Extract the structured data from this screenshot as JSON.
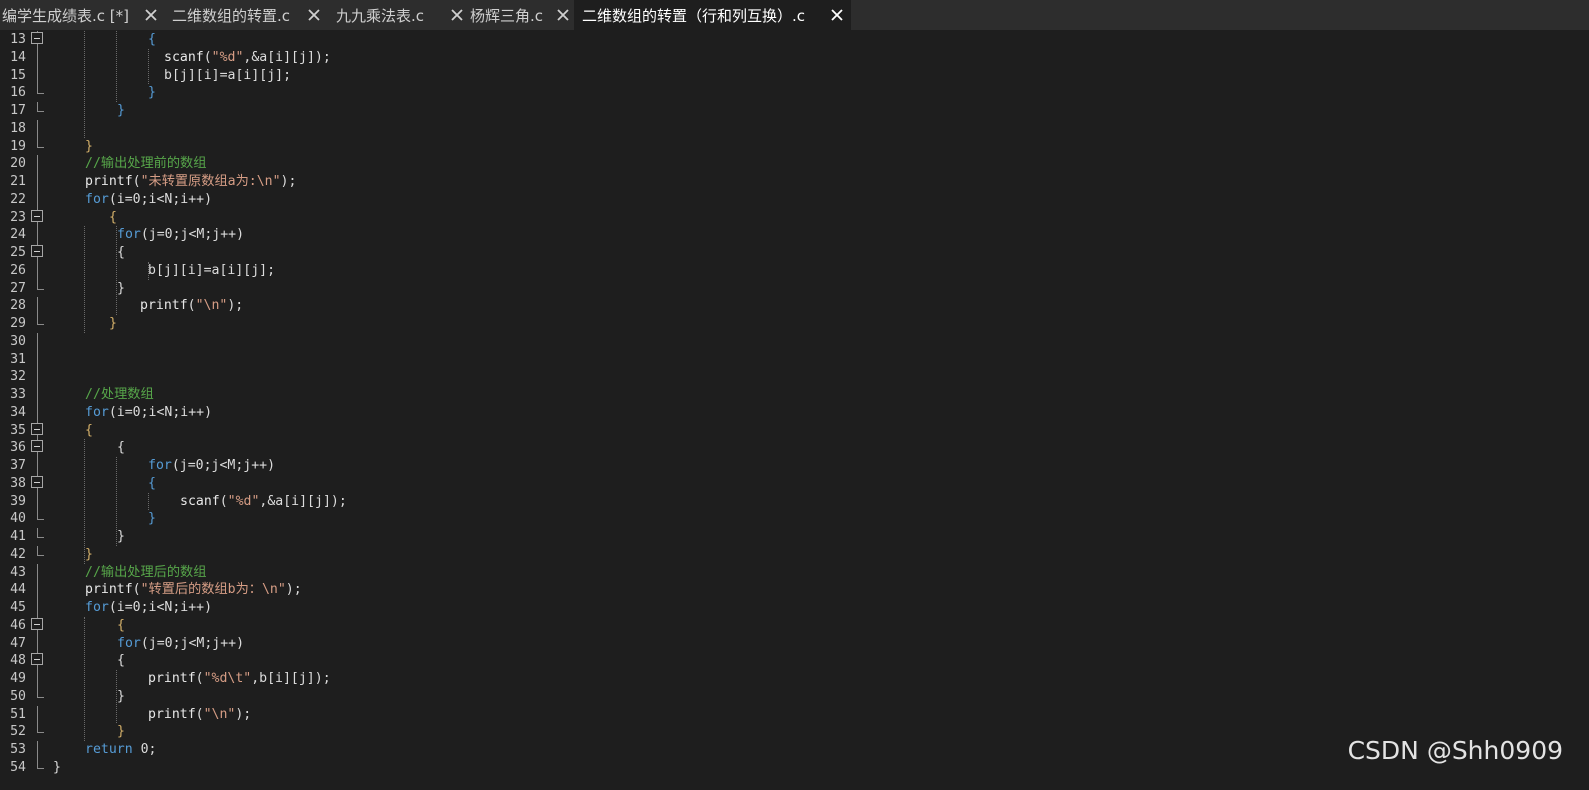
{
  "colors": {
    "background": "#1e1e1e",
    "tab_bar": "#2d2d2d",
    "keyword": "#569cd6",
    "function": "#e8e8e8",
    "string": "#d69d85",
    "comment": "#57a64a",
    "brace": "#d4b06a",
    "text": "#dcdcdc"
  },
  "tabs": [
    {
      "title": "编学生成绩表.c [*]",
      "close_icon": "close-icon",
      "active": false
    },
    {
      "title": "二维数组的转置.c",
      "close_icon": "close-icon",
      "active": false
    },
    {
      "title": "九九乘法表.c",
      "close_icon": "close-icon",
      "active": false
    },
    {
      "title": "杨辉三角.c",
      "close_icon": "close-icon",
      "active": false
    },
    {
      "title": "二维数组的转置（行和列互换）.c",
      "close_icon": "close-icon",
      "active": true
    }
  ],
  "editor": {
    "lines": [
      {
        "number": "13",
        "fold": "start",
        "tokens": [
          {
            "t": "{",
            "c": "bk"
          }
        ]
      },
      {
        "number": "14",
        "fold": "line",
        "tokens": [
          {
            "t": "scanf",
            "c": "fn"
          },
          {
            "t": "(",
            "c": "tx"
          },
          {
            "t": "\"%d\"",
            "c": "st"
          },
          {
            "t": ",&a[i][j]);",
            "c": "tx"
          }
        ]
      },
      {
        "number": "15",
        "fold": "line",
        "tokens": [
          {
            "t": "b[j][i]=a[i][j];",
            "c": "tx"
          }
        ]
      },
      {
        "number": "16",
        "fold": "end",
        "tokens": [
          {
            "t": "}",
            "c": "bk"
          }
        ]
      },
      {
        "number": "17",
        "fold": "end",
        "tokens": [
          {
            "t": "}",
            "c": "bk"
          }
        ]
      },
      {
        "number": "18",
        "fold": "line",
        "tokens": []
      },
      {
        "number": "19",
        "fold": "end",
        "tokens": [
          {
            "t": "}",
            "c": "br"
          }
        ]
      },
      {
        "number": "20",
        "fold": "line",
        "tokens": [
          {
            "t": "//输出处理前的数组",
            "c": "cm"
          }
        ]
      },
      {
        "number": "21",
        "fold": "line",
        "tokens": [
          {
            "t": "printf",
            "c": "fn"
          },
          {
            "t": "(",
            "c": "tx"
          },
          {
            "t": "\"未转置原数组a为:\\n\"",
            "c": "st"
          },
          {
            "t": ");",
            "c": "tx"
          }
        ]
      },
      {
        "number": "22",
        "fold": "line",
        "tokens": [
          {
            "t": "for",
            "c": "kw"
          },
          {
            "t": "(i=0;i<N;i++)",
            "c": "tx"
          }
        ]
      },
      {
        "number": "23",
        "fold": "start",
        "tokens": [
          {
            "t": "{",
            "c": "br"
          }
        ]
      },
      {
        "number": "24",
        "fold": "line",
        "tokens": [
          {
            "t": "for",
            "c": "kw"
          },
          {
            "t": "(j=0;j<M;j++)",
            "c": "tx"
          }
        ]
      },
      {
        "number": "25",
        "fold": "start",
        "tokens": [
          {
            "t": "{",
            "c": "tx"
          }
        ]
      },
      {
        "number": "26",
        "fold": "line",
        "tokens": [
          {
            "t": "b[j][i]=a[i][j];",
            "c": "tx"
          }
        ]
      },
      {
        "number": "27",
        "fold": "end",
        "tokens": [
          {
            "t": "}",
            "c": "tx"
          }
        ]
      },
      {
        "number": "28",
        "fold": "line",
        "tokens": [
          {
            "t": "printf",
            "c": "fn"
          },
          {
            "t": "(",
            "c": "tx"
          },
          {
            "t": "\"\\n\"",
            "c": "st"
          },
          {
            "t": ");",
            "c": "tx"
          }
        ]
      },
      {
        "number": "29",
        "fold": "end",
        "tokens": [
          {
            "t": "}",
            "c": "br"
          }
        ]
      },
      {
        "number": "30",
        "fold": "line",
        "tokens": []
      },
      {
        "number": "31",
        "fold": "line",
        "tokens": []
      },
      {
        "number": "32",
        "fold": "line",
        "tokens": []
      },
      {
        "number": "33",
        "fold": "line",
        "tokens": [
          {
            "t": "//处理数组",
            "c": "cm"
          }
        ]
      },
      {
        "number": "34",
        "fold": "line",
        "tokens": [
          {
            "t": "for",
            "c": "kw"
          },
          {
            "t": "(i=0;i<N;i++)",
            "c": "tx"
          }
        ]
      },
      {
        "number": "35",
        "fold": "start",
        "tokens": [
          {
            "t": "{",
            "c": "br"
          }
        ]
      },
      {
        "number": "36",
        "fold": "start",
        "tokens": [
          {
            "t": "{",
            "c": "tx"
          }
        ]
      },
      {
        "number": "37",
        "fold": "line",
        "tokens": [
          {
            "t": "for",
            "c": "kw"
          },
          {
            "t": "(j=0;j<M;j++)",
            "c": "tx"
          }
        ]
      },
      {
        "number": "38",
        "fold": "start",
        "tokens": [
          {
            "t": "{",
            "c": "bk"
          }
        ]
      },
      {
        "number": "39",
        "fold": "line",
        "tokens": [
          {
            "t": "scanf",
            "c": "fn"
          },
          {
            "t": "(",
            "c": "tx"
          },
          {
            "t": "\"%d\"",
            "c": "st"
          },
          {
            "t": ",&a[i][j]);",
            "c": "tx"
          }
        ]
      },
      {
        "number": "40",
        "fold": "end",
        "tokens": [
          {
            "t": "}",
            "c": "bk"
          }
        ]
      },
      {
        "number": "41",
        "fold": "end",
        "tokens": [
          {
            "t": "}",
            "c": "tx"
          }
        ]
      },
      {
        "number": "42",
        "fold": "end",
        "tokens": [
          {
            "t": "}",
            "c": "br"
          }
        ]
      },
      {
        "number": "43",
        "fold": "line",
        "tokens": [
          {
            "t": "//输出处理后的数组",
            "c": "cm"
          }
        ]
      },
      {
        "number": "44",
        "fold": "line",
        "tokens": [
          {
            "t": "printf",
            "c": "fn"
          },
          {
            "t": "(",
            "c": "tx"
          },
          {
            "t": "\"转置后的数组b为：\\n\"",
            "c": "st"
          },
          {
            "t": ");",
            "c": "tx"
          }
        ]
      },
      {
        "number": "45",
        "fold": "line",
        "tokens": [
          {
            "t": "for",
            "c": "kw"
          },
          {
            "t": "(i=0;i<N;i++)",
            "c": "tx"
          }
        ]
      },
      {
        "number": "46",
        "fold": "start",
        "tokens": [
          {
            "t": "{",
            "c": "br"
          }
        ]
      },
      {
        "number": "47",
        "fold": "line",
        "tokens": [
          {
            "t": "for",
            "c": "kw"
          },
          {
            "t": "(j=0;j<M;j++)",
            "c": "tx"
          }
        ]
      },
      {
        "number": "48",
        "fold": "start",
        "tokens": [
          {
            "t": "{",
            "c": "tx"
          }
        ]
      },
      {
        "number": "49",
        "fold": "line",
        "tokens": [
          {
            "t": "printf",
            "c": "fn"
          },
          {
            "t": "(",
            "c": "tx"
          },
          {
            "t": "\"%d\\t\"",
            "c": "st"
          },
          {
            "t": ",b[i][j]);",
            "c": "tx"
          }
        ]
      },
      {
        "number": "50",
        "fold": "end",
        "tokens": [
          {
            "t": "}",
            "c": "tx"
          }
        ]
      },
      {
        "number": "51",
        "fold": "line",
        "tokens": [
          {
            "t": "printf",
            "c": "fn"
          },
          {
            "t": "(",
            "c": "tx"
          },
          {
            "t": "\"\\n\"",
            "c": "st"
          },
          {
            "t": ");",
            "c": "tx"
          }
        ]
      },
      {
        "number": "52",
        "fold": "end",
        "tokens": [
          {
            "t": "}",
            "c": "br"
          }
        ]
      },
      {
        "number": "53",
        "fold": "line",
        "tokens": [
          {
            "t": "return",
            "c": "kw"
          },
          {
            "t": " 0;",
            "c": "tx"
          }
        ]
      },
      {
        "number": "54",
        "fold": "end",
        "tokens": [
          {
            "t": "}",
            "c": "tx"
          }
        ]
      }
    ]
  },
  "watermark": "CSDN @Shh0909"
}
